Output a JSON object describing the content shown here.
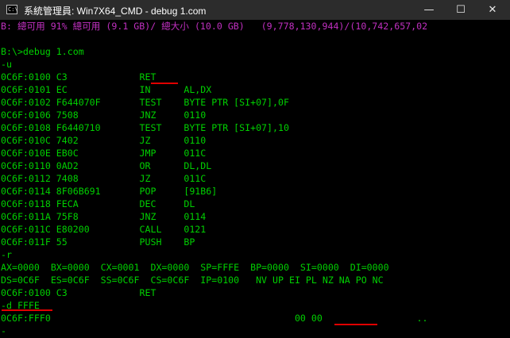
{
  "window": {
    "icon_label": "C:\\",
    "title": "系統管理員: Win7X64_CMD - debug  1.com",
    "buttons": {
      "minimize": "—",
      "maximize": "☐",
      "close": "✕"
    }
  },
  "console": {
    "colors": {
      "text": "#00d000",
      "status": "#c030c0",
      "underline": "#e00000",
      "background": "#000000"
    },
    "lines": [
      "B: 總可用 91% 總可用 (9.1 GB)/ 總大小 (10.0 GB)   (9,778,130,944)/(10,742,657,02",
      "",
      "B:\\>debug 1.com",
      "-u",
      "0C6F:0100 C3             RET",
      "0C6F:0101 EC             IN      AL,DX",
      "0C6F:0102 F644070F       TEST    BYTE PTR [SI+07],0F",
      "0C6F:0106 7508           JNZ     0110",
      "0C6F:0108 F6440710       TEST    BYTE PTR [SI+07],10",
      "0C6F:010C 7402           JZ      0110",
      "0C6F:010E EB0C           JMP     011C",
      "0C6F:0110 0AD2           OR      DL,DL",
      "0C6F:0112 7408           JZ      011C",
      "0C6F:0114 8F06B691       POP     [91B6]",
      "0C6F:0118 FECA           DEC     DL",
      "0C6F:011A 75F8           JNZ     0114",
      "0C6F:011C E80200         CALL    0121",
      "0C6F:011F 55             PUSH    BP",
      "-r",
      "AX=0000  BX=0000  CX=0001  DX=0000  SP=FFFE  BP=0000  SI=0000  DI=0000",
      "DS=0C6F  ES=0C6F  SS=0C6F  CS=0C6F  IP=0100   NV UP EI PL NZ NA PO NC",
      "0C6F:0100 C3             RET",
      "-d FFFE",
      "0C6F:FFF0                                            00 00                 ..",
      "-"
    ]
  }
}
